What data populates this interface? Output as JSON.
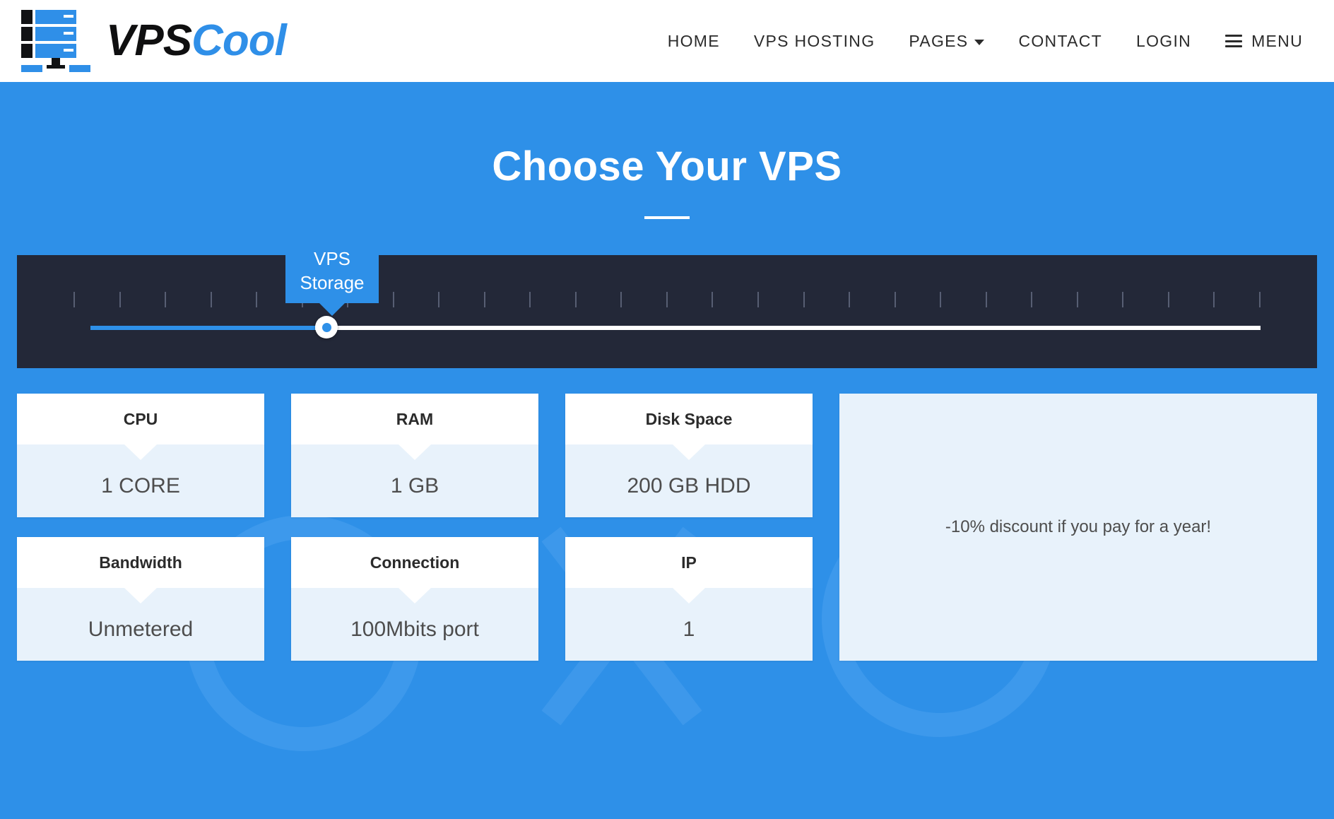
{
  "header": {
    "brand": {
      "primary": "VPS",
      "accent": "Cool",
      "logo_icon": "server-rack-icon"
    },
    "nav": [
      {
        "label": "HOME",
        "name": "nav-home",
        "caret": false,
        "burger": false
      },
      {
        "label": "VPS HOSTING",
        "name": "nav-vps-hosting",
        "caret": false,
        "burger": false
      },
      {
        "label": "PAGES",
        "name": "nav-pages",
        "caret": true,
        "burger": false
      },
      {
        "label": "CONTACT",
        "name": "nav-contact",
        "caret": false,
        "burger": false
      },
      {
        "label": "LOGIN",
        "name": "nav-login",
        "caret": false,
        "burger": false
      },
      {
        "label": "MENU",
        "name": "nav-menu",
        "caret": false,
        "burger": true
      }
    ]
  },
  "hero": {
    "title": "Choose Your VPS"
  },
  "slider": {
    "tooltip_line1": "VPS",
    "tooltip_line2": "Storage",
    "tick_count": 27,
    "fill_percent": 23,
    "panel_color": "#232838",
    "fill_color": "#2e90e8",
    "track_color": "#ffffff"
  },
  "specs": [
    {
      "title": "CPU",
      "value": "1 CORE",
      "name": "spec-card-cpu"
    },
    {
      "title": "RAM",
      "value": "1 GB",
      "name": "spec-card-ram"
    },
    {
      "title": "Disk Space",
      "value": "200 GB HDD",
      "name": "spec-card-disk-space"
    },
    {
      "title": "Bandwidth",
      "value": "Unmetered",
      "name": "spec-card-bandwidth"
    },
    {
      "title": "Connection",
      "value": "100Mbits port",
      "name": "spec-card-connection"
    },
    {
      "title": "IP",
      "value": "1",
      "name": "spec-card-ip"
    }
  ],
  "promo": {
    "text": "-10% discount if you pay for a year!"
  },
  "colors": {
    "brand_blue": "#2e90e8",
    "panel_dark": "#232838",
    "card_body": "#e8f2fb",
    "text_dark": "#2b2b2b"
  }
}
